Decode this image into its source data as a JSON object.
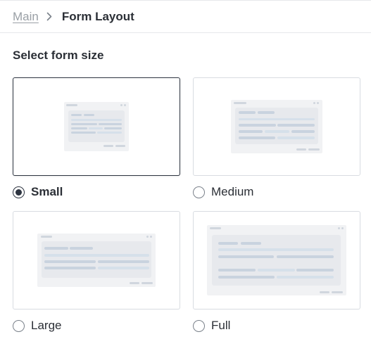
{
  "breadcrumb": {
    "parent": "Main",
    "current": "Form Layout"
  },
  "section_title": "Select form size",
  "options": [
    {
      "label": "Small",
      "selected": true
    },
    {
      "label": "Medium",
      "selected": false
    },
    {
      "label": "Large",
      "selected": false
    },
    {
      "label": "Full",
      "selected": false
    }
  ],
  "colors": {
    "preview_bg": "#f1f2f4",
    "preview_panel": "#e7e9ed",
    "preview_bar_dark": "#c9d3df",
    "preview_bar_light": "#d6e0ea",
    "selected_border": "#2d3440"
  }
}
